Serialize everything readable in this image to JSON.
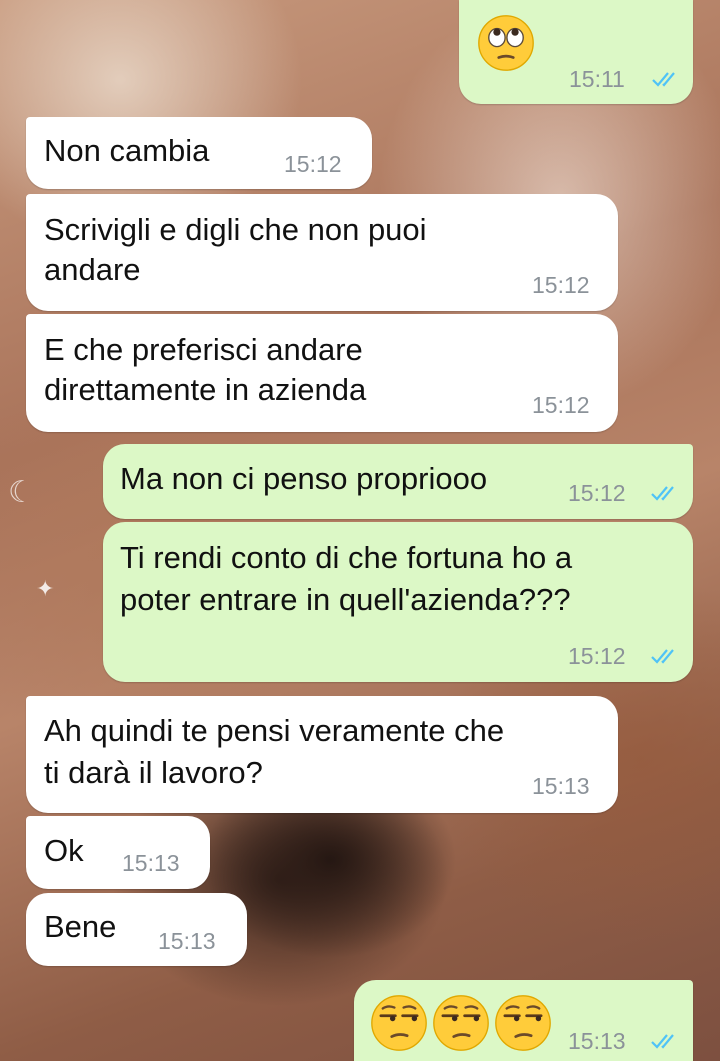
{
  "chat": {
    "messages": [
      {
        "id": "m1",
        "direction": "outgoing",
        "emoji": [
          "face-with-rolling-eyes"
        ],
        "time": "15:11",
        "status": "read"
      },
      {
        "id": "m2",
        "direction": "incoming",
        "text": [
          "Non cambia"
        ],
        "time": "15:12"
      },
      {
        "id": "m3",
        "direction": "incoming",
        "text": [
          "Scrivigli e digli che non puoi",
          "andare"
        ],
        "time": "15:12"
      },
      {
        "id": "m4",
        "direction": "incoming",
        "text": [
          "E che preferisci andare",
          "direttamente in azienda"
        ],
        "time": "15:12"
      },
      {
        "id": "m5",
        "direction": "outgoing",
        "text": [
          "Ma non ci penso propriooo"
        ],
        "time": "15:12",
        "status": "read"
      },
      {
        "id": "m6",
        "direction": "outgoing",
        "text": [
          "Ti rendi conto di che fortuna ho a",
          "poter entrare in quell'azienda???"
        ],
        "time": "15:12",
        "status": "read"
      },
      {
        "id": "m7",
        "direction": "incoming",
        "text": [
          "Ah quindi te pensi veramente che",
          "ti darà il lavoro?"
        ],
        "time": "15:13"
      },
      {
        "id": "m8",
        "direction": "incoming",
        "text": [
          "Ok"
        ],
        "time": "15:13"
      },
      {
        "id": "m9",
        "direction": "incoming",
        "text": [
          "Bene"
        ],
        "time": "15:13"
      },
      {
        "id": "m10",
        "direction": "outgoing",
        "emoji": [
          "unamused-face",
          "unamused-face",
          "unamused-face"
        ],
        "time": "15:13",
        "status": "read"
      }
    ]
  },
  "colors": {
    "incoming_bubble": "#ffffff",
    "outgoing_bubble": "#dcf8c6",
    "read_ticks": "#4fc3f7",
    "timestamp": "#8b9299"
  }
}
